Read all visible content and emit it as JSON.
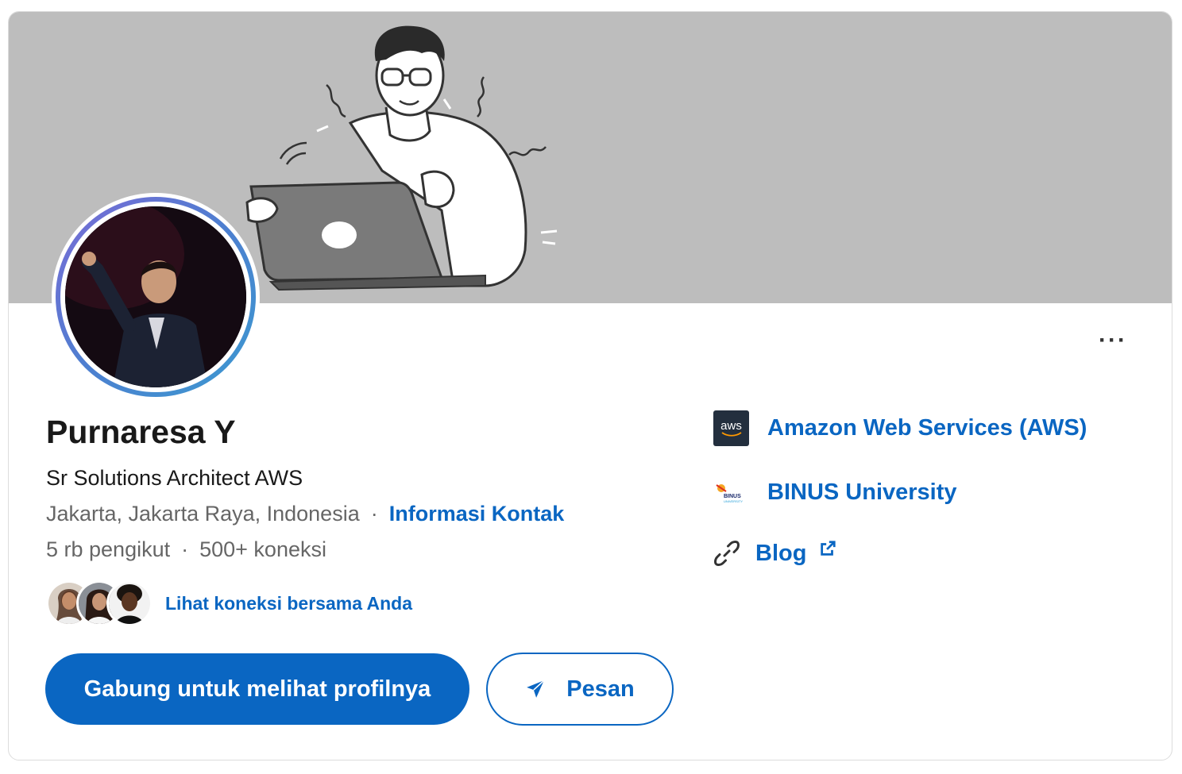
{
  "profile": {
    "name": "Purnaresa Y",
    "headline": "Sr Solutions Architect AWS",
    "location": "Jakarta, Jakarta Raya, Indonesia",
    "separator": "·",
    "contact_info_label": "Informasi Kontak",
    "followers": "5 rb pengikut",
    "connections": "500+ koneksi",
    "mutual_connections_label": "Lihat koneksi bersama Anda"
  },
  "actions": {
    "more_label": "···",
    "join_label": "Gabung untuk melihat profilnya",
    "message_label": "Pesan"
  },
  "sidebar": {
    "company": {
      "name": "Amazon Web Services (AWS)",
      "logo_text": "aws",
      "icon": "aws-logo-icon"
    },
    "education": {
      "name": "BINUS University",
      "logo_text": "BINUS",
      "logo_subtext": "UNIVERSITY",
      "icon": "binus-logo-icon"
    },
    "website": {
      "name": "Blog",
      "icon": "link-icon",
      "external_icon": "external-link-icon"
    }
  },
  "colors": {
    "brand_blue": "#0a66c2",
    "banner_gray": "#bdbdbd",
    "text_primary": "#191919",
    "text_secondary": "#666666"
  }
}
